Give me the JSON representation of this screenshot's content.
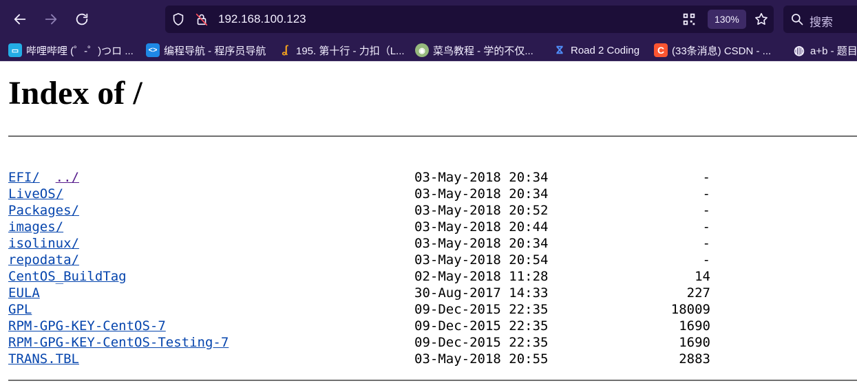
{
  "browser": {
    "url": "192.168.100.123",
    "zoom": "130%",
    "search_placeholder": "搜索"
  },
  "bookmarks": [
    {
      "label": "哔哩哔哩 (゜-゜)つロ ...",
      "icon": "bilibili-icon"
    },
    {
      "label": "编程导航 - 程序员导航",
      "icon": "code-nav-icon"
    },
    {
      "label": "195. 第十行 - 力扣（L...",
      "icon": "leetcode-icon"
    },
    {
      "label": "菜鸟教程 - 学的不仅...",
      "icon": "runoob-icon"
    },
    {
      "label": "Road 2 Coding",
      "icon": "footprint-icon"
    },
    {
      "label": "(33条消息) CSDN - ...",
      "icon": "csdn-icon"
    },
    {
      "label": "a+b - 题目",
      "icon": "globe-icon"
    }
  ],
  "page": {
    "title": "Index of /",
    "parent_link": "../",
    "entries": [
      {
        "name": "EFI/",
        "date": "03-May-2018 20:34",
        "size": "-"
      },
      {
        "name": "LiveOS/",
        "date": "03-May-2018 20:34",
        "size": "-"
      },
      {
        "name": "Packages/",
        "date": "03-May-2018 20:52",
        "size": "-"
      },
      {
        "name": "images/",
        "date": "03-May-2018 20:44",
        "size": "-"
      },
      {
        "name": "isolinux/",
        "date": "03-May-2018 20:34",
        "size": "-"
      },
      {
        "name": "repodata/",
        "date": "03-May-2018 20:54",
        "size": "-"
      },
      {
        "name": "CentOS_BuildTag",
        "date": "02-May-2018 11:28",
        "size": "14"
      },
      {
        "name": "EULA",
        "date": "30-Aug-2017 14:33",
        "size": "227"
      },
      {
        "name": "GPL",
        "date": "09-Dec-2015 22:35",
        "size": "18009"
      },
      {
        "name": "RPM-GPG-KEY-CentOS-7",
        "date": "09-Dec-2015 22:35",
        "size": "1690"
      },
      {
        "name": "RPM-GPG-KEY-CentOS-Testing-7",
        "date": "09-Dec-2015 22:35",
        "size": "1690"
      },
      {
        "name": "TRANS.TBL",
        "date": "03-May-2018 20:55",
        "size": "2883"
      }
    ]
  }
}
